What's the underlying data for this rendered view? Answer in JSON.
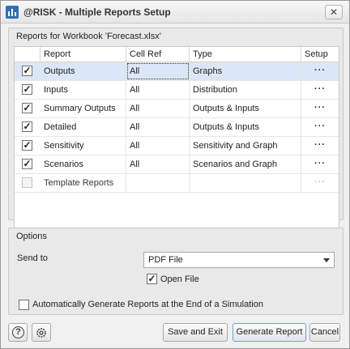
{
  "window": {
    "title": "@RISK - Multiple Reports Setup",
    "close_glyph": "✕"
  },
  "reports_group": {
    "title": "Reports for Workbook 'Forecast.xlsx'",
    "columns": [
      "Report",
      "Cell Ref",
      "Type",
      "Setup"
    ],
    "rows": [
      {
        "checked": "✓",
        "report": "Outputs",
        "cell_ref": "All",
        "type": "Graphs",
        "setup": "···"
      },
      {
        "checked": "✓",
        "report": "Inputs",
        "cell_ref": "All",
        "type": "Distribution",
        "setup": "···"
      },
      {
        "checked": "✓",
        "report": "Summary Outputs",
        "cell_ref": "All",
        "type": "Outputs & Inputs",
        "setup": "···"
      },
      {
        "checked": "✓",
        "report": "Detailed",
        "cell_ref": "All",
        "type": "Outputs & Inputs",
        "setup": "···"
      },
      {
        "checked": "✓",
        "report": "Sensitivity",
        "cell_ref": "All",
        "type": "Sensitivity and Graph",
        "setup": "···"
      },
      {
        "checked": "✓",
        "report": "Scenarios",
        "cell_ref": "All",
        "type": "Scenarios and Graph",
        "setup": "···"
      },
      {
        "checked": "",
        "report": "Template Reports",
        "cell_ref": "",
        "type": "",
        "setup": "···"
      }
    ]
  },
  "options_group": {
    "title": "Options",
    "send_to_label": "Send to",
    "send_to_value": "PDF File",
    "open_file_label": "Open File",
    "open_file_checked": "✓",
    "auto_generate_label": "Automatically Generate Reports at the End of a Simulation",
    "auto_generate_checked": ""
  },
  "footer": {
    "help_icon": "?",
    "save_exit_label": "Save and Exit",
    "generate_label": "Generate Report",
    "cancel_label": "Cancel"
  }
}
